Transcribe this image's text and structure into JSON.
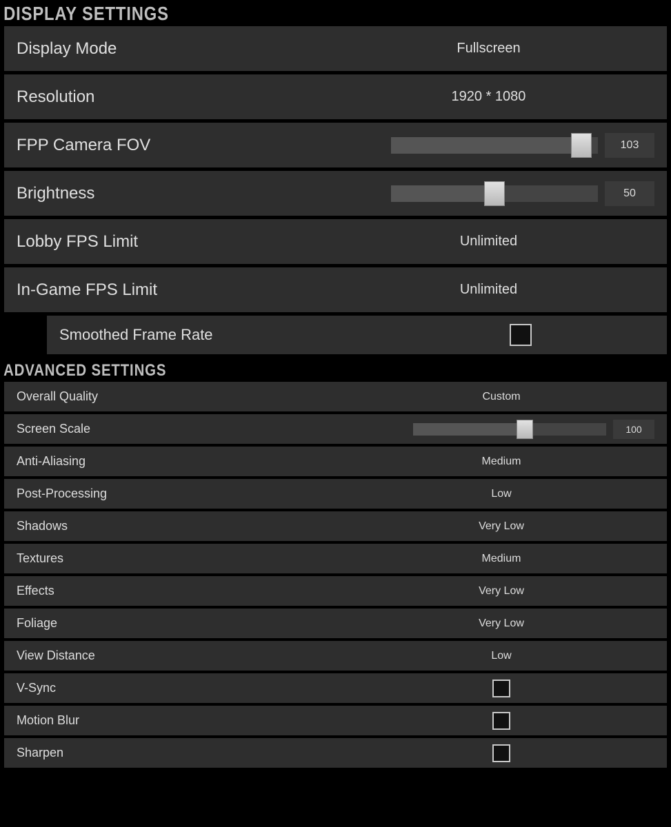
{
  "display": {
    "title": "DISPLAY SETTINGS",
    "mode": {
      "label": "Display Mode",
      "value": "Fullscreen"
    },
    "resolution": {
      "label": "Resolution",
      "value": "1920 * 1080"
    },
    "fov": {
      "label": "FPP Camera FOV",
      "value": "103",
      "percent": 92
    },
    "brightness": {
      "label": "Brightness",
      "value": "50",
      "percent": 50
    },
    "lobbyFps": {
      "label": "Lobby FPS Limit",
      "value": "Unlimited"
    },
    "gameFps": {
      "label": "In-Game FPS Limit",
      "value": "Unlimited"
    },
    "smoothed": {
      "label": "Smoothed Frame Rate",
      "checked": false
    }
  },
  "advanced": {
    "title": "ADVANCED SETTINGS",
    "overall": {
      "label": "Overall Quality",
      "value": "Custom"
    },
    "scale": {
      "label": "Screen Scale",
      "value": "100",
      "percent": 58
    },
    "aa": {
      "label": "Anti-Aliasing",
      "value": "Medium"
    },
    "post": {
      "label": "Post-Processing",
      "value": "Low"
    },
    "shadows": {
      "label": "Shadows",
      "value": "Very Low"
    },
    "textures": {
      "label": "Textures",
      "value": "Medium"
    },
    "effects": {
      "label": "Effects",
      "value": "Very Low"
    },
    "foliage": {
      "label": "Foliage",
      "value": "Very Low"
    },
    "view": {
      "label": "View Distance",
      "value": "Low"
    },
    "vsync": {
      "label": "V-Sync",
      "checked": false
    },
    "blur": {
      "label": "Motion Blur",
      "checked": false
    },
    "sharpen": {
      "label": "Sharpen",
      "checked": false
    }
  }
}
